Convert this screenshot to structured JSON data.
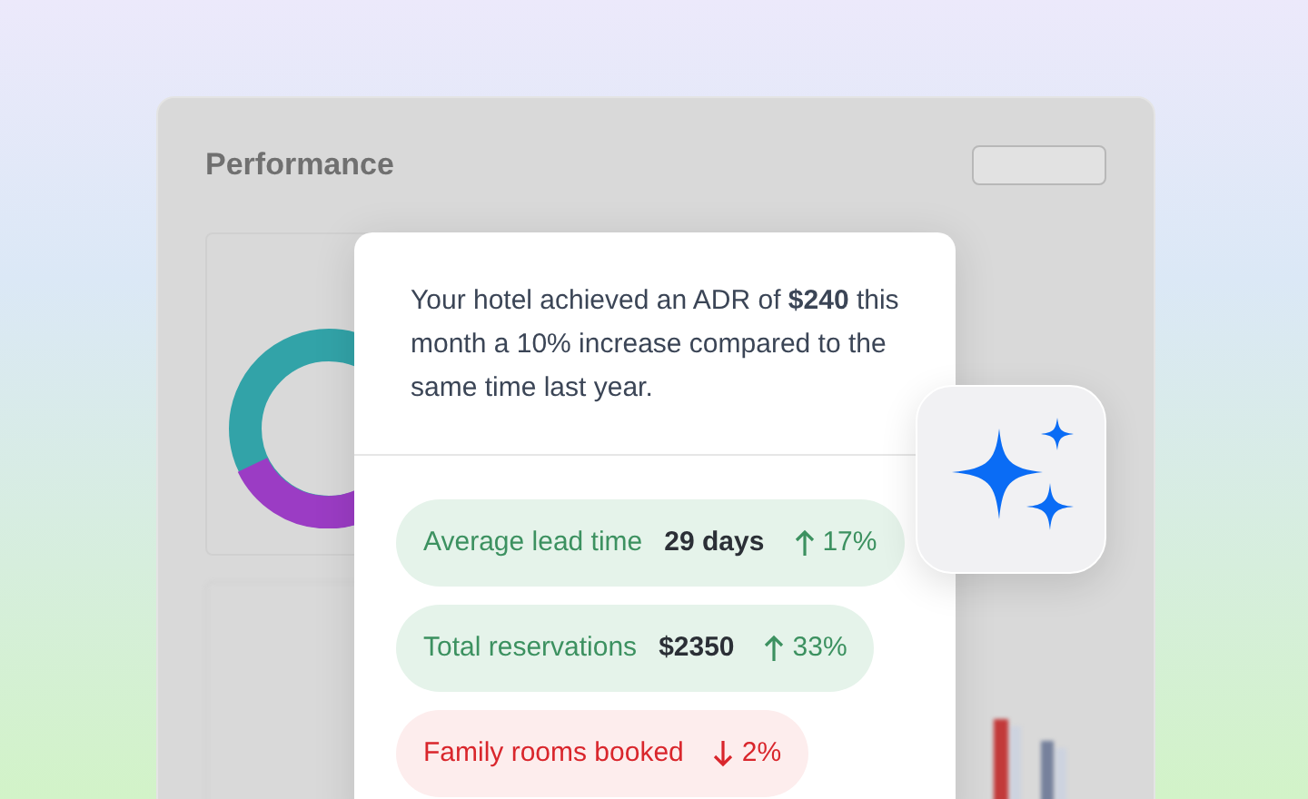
{
  "dashboard": {
    "title": "Performance"
  },
  "insight": {
    "message": "Your hotel achieved an ADR of **$240** this month a 10% increase compared to the same time last year.",
    "metrics": [
      {
        "kind": "up",
        "label": "Average lead time",
        "value": "29 days",
        "change": "17%"
      },
      {
        "kind": "up",
        "label": "Total reservations",
        "value": "$2350",
        "change": "33%"
      },
      {
        "kind": "down",
        "label": "Family rooms booked",
        "change": "2%"
      }
    ]
  }
}
